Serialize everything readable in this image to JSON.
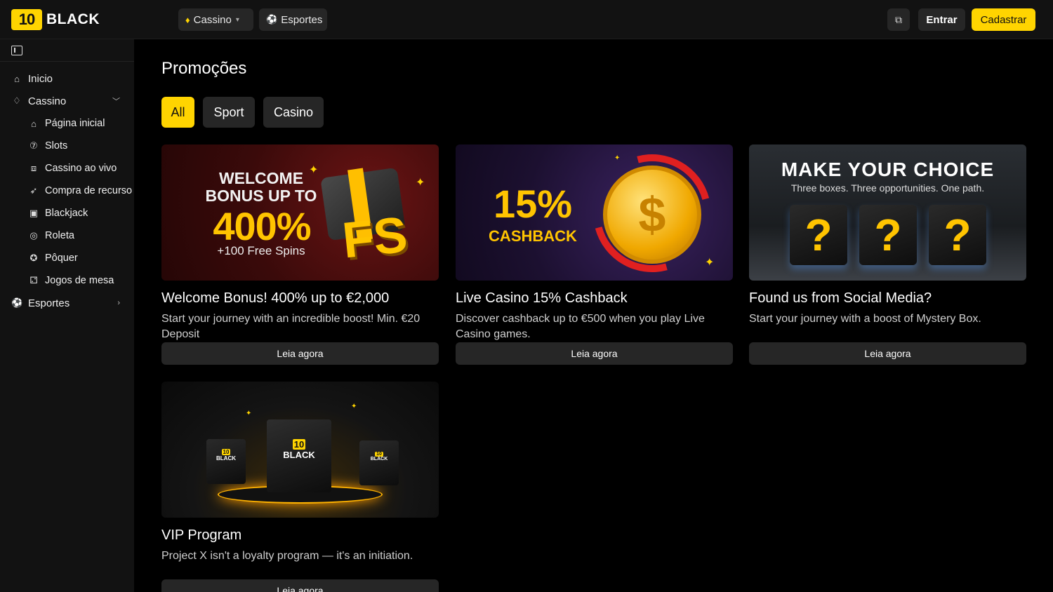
{
  "header": {
    "logo_number": "10",
    "logo_text": "BLACK",
    "tabs": [
      {
        "label": "Cassino",
        "icon": "cards-icon",
        "has_dropdown": true
      },
      {
        "label": "Esportes",
        "icon": "ball-icon",
        "has_dropdown": false
      }
    ],
    "chat_icon": "chat-icon",
    "login_label": "Entrar",
    "register_label": "Cadastrar"
  },
  "sidebar": {
    "collapse_icon": "sidebar-toggle-icon",
    "items": [
      {
        "label": "Inicio",
        "icon": "home-icon",
        "level": 1
      },
      {
        "label": "Cassino",
        "icon": "cards-icon",
        "level": 1,
        "expanded": true
      },
      {
        "label": "Página inicial",
        "icon": "home-icon",
        "level": 2
      },
      {
        "label": "Slots",
        "icon": "slots-icon",
        "level": 2
      },
      {
        "label": "Cassino ao vivo",
        "icon": "live-icon",
        "level": 2
      },
      {
        "label": "Compra de recurso",
        "icon": "rocket-icon",
        "level": 2
      },
      {
        "label": "Blackjack",
        "icon": "blackjack-icon",
        "level": 2
      },
      {
        "label": "Roleta",
        "icon": "roulette-icon",
        "level": 2
      },
      {
        "label": "Pôquer",
        "icon": "poker-chip-icon",
        "level": 2
      },
      {
        "label": "Jogos de mesa",
        "icon": "dice-icon",
        "level": 2
      },
      {
        "label": "Esportes",
        "icon": "ball-icon",
        "level": 1,
        "expanded": false
      }
    ]
  },
  "main": {
    "title": "Promoções",
    "filters": [
      {
        "label": "All",
        "active": true
      },
      {
        "label": "Sport",
        "active": false
      },
      {
        "label": "Casino",
        "active": false
      }
    ],
    "promos": [
      {
        "title": "Welcome Bonus! 400% up to €2,000",
        "description": "Start your journey with an incredible boost! Min. €20 Deposit",
        "button": "Leia agora",
        "banner": {
          "line1": "WELCOME",
          "line2": "BONUS UP TO",
          "big": "400%",
          "sub": "+100 Free Spins",
          "badge": "FS"
        }
      },
      {
        "title": "Live Casino 15% Cashback",
        "description": "Discover cashback up to €500 when you play Live Casino games.",
        "button": "Leia agora",
        "banner": {
          "big": "15%",
          "sub": "CASHBACK",
          "coin": "$"
        }
      },
      {
        "title": "Found us from Social Media?",
        "description": "Start your journey with a boost of Mystery Box.",
        "button": "Leia agora",
        "banner": {
          "headline": "MAKE YOUR CHOICE",
          "sub": "Three boxes. Three opportunities. One path.",
          "mark": "?"
        }
      },
      {
        "title": "VIP Program",
        "description": "Project X isn't a loyalty program — it's an initiation.",
        "button": "Leia agora",
        "banner": {
          "logo_number": "10",
          "logo_text": "BLACK"
        }
      }
    ]
  },
  "colors": {
    "accent": "#ffd400",
    "background": "#000000",
    "panel": "#121212",
    "button": "#262626"
  }
}
